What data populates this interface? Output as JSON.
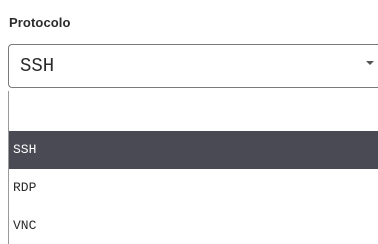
{
  "field": {
    "label": "Protocolo",
    "selected_value": "SSH",
    "arrow_icon": "caret-down-icon"
  },
  "dropdown": {
    "blank_option": "",
    "options": [
      {
        "label": "SSH",
        "highlighted": true
      },
      {
        "label": "RDP",
        "highlighted": false
      },
      {
        "label": "VNC",
        "highlighted": false
      }
    ],
    "highlight_color": "#4a4a55"
  }
}
